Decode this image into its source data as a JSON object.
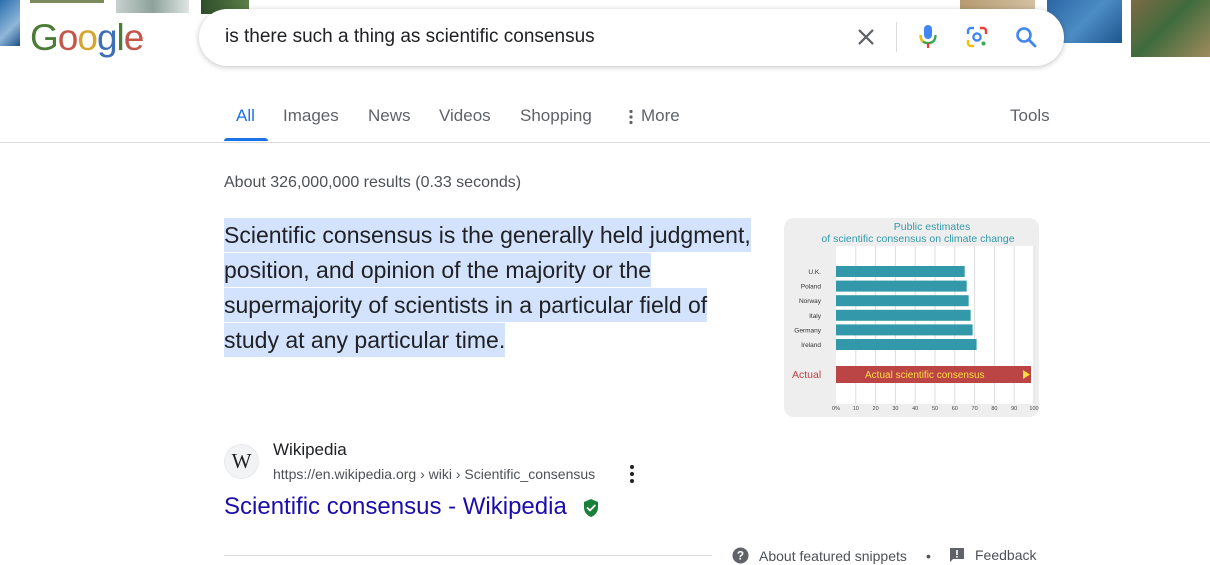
{
  "logo": {
    "letters": [
      "G",
      "o",
      "o",
      "g",
      "l",
      "e"
    ],
    "colors": [
      "#4a7c36",
      "#c3554b",
      "#d6a52d",
      "#3f6fb4",
      "#4a7c36",
      "#c3554b"
    ]
  },
  "search": {
    "query": "is there such a thing as scientific consensus"
  },
  "tabs": [
    {
      "label": "All",
      "active": true
    },
    {
      "label": "Images",
      "active": false
    },
    {
      "label": "News",
      "active": false
    },
    {
      "label": "Videos",
      "active": false
    },
    {
      "label": "Shopping",
      "active": false
    },
    {
      "label": "More",
      "active": false
    }
  ],
  "tools_label": "Tools",
  "result_stats": "About 326,000,000 results (0.33 seconds)",
  "featured_snippet": {
    "text": "Scientific consensus is the generally held judgment, position, and opinion of the majority or the supermajority of scientists in a particular field of study at any particular time."
  },
  "chart_data": {
    "type": "bar",
    "orientation": "horizontal",
    "title": "Public estimates",
    "subtitle": "of scientific consensus on climate change",
    "categories": [
      "U.K.",
      "Poland",
      "Norway",
      "Italy",
      "Germany",
      "Ireland"
    ],
    "values": [
      65,
      66,
      67,
      68,
      69,
      71
    ],
    "actual": {
      "label": "Actual",
      "bar_label": "Actual scientific consensus",
      "value": 100
    },
    "x_ticks": [
      "0%",
      "10",
      "20",
      "30",
      "40",
      "50",
      "60",
      "70",
      "80",
      "90",
      "100"
    ],
    "xlim": [
      0,
      100
    ],
    "bar_color": "#3399aa",
    "actual_color": "#bb4444",
    "actual_text_color": "#ffdd44",
    "grid": true
  },
  "result": {
    "favicon_letter": "W",
    "site_name": "Wikipedia",
    "url": "https://en.wikipedia.org › wiki › Scientific_consensus",
    "title": "Scientific consensus - Wikipedia",
    "verified_icon": "verified-shield-icon",
    "verified_color": "#188038"
  },
  "footer": {
    "about_label": "About featured snippets",
    "separator": "•",
    "feedback_label": "Feedback"
  },
  "colors": {
    "accent": "#1a73e8",
    "link": "#1a0dab",
    "highlight": "#d3e3fd"
  }
}
